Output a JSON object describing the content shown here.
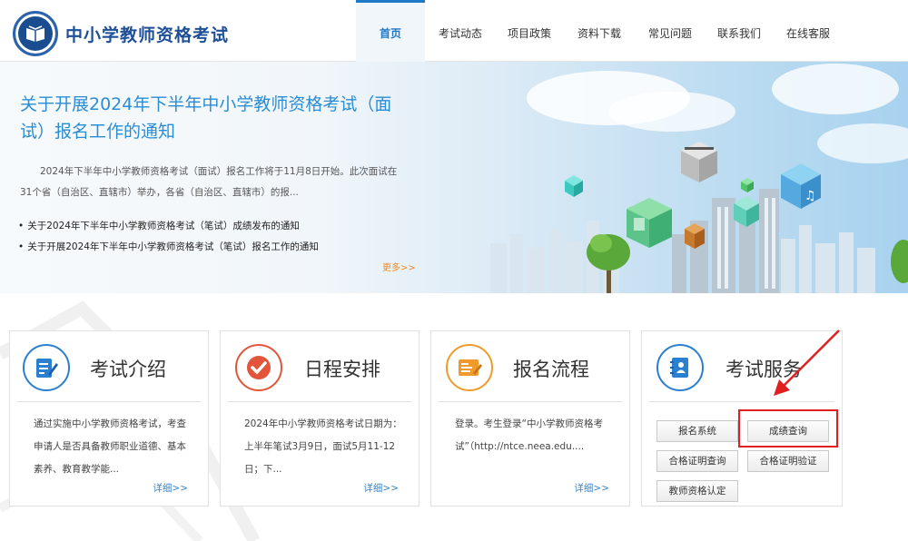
{
  "header": {
    "site_title": "中小学教师资格考试",
    "nav": [
      {
        "label": "首页",
        "active": true
      },
      {
        "label": "考试动态",
        "active": false
      },
      {
        "label": "项目政策",
        "active": false
      },
      {
        "label": "资料下载",
        "active": false
      },
      {
        "label": "常见问题",
        "active": false
      },
      {
        "label": "联系我们",
        "active": false
      },
      {
        "label": "在线客服",
        "active": false
      }
    ]
  },
  "banner": {
    "headline": "关于开展2024年下半年中小学教师资格考试（面试）报名工作的通知",
    "summary": "2024年下半年中小学教师资格考试（面试）报名工作将于11月8日开始。此次面试在31个省（自治区、直辖市）举办，各省（自治区、直辖市）的报...",
    "links": [
      "关于2024年下半年中小学教师资格考试（笔试）成绩发布的通知",
      "关于开展2024年下半年中小学教师资格考试（笔试）报名工作的通知"
    ],
    "more": "更多>>"
  },
  "cards": [
    {
      "title": "考试介绍",
      "icon": "document-edit-icon",
      "body": "通过实施中小学教师资格考试，考查申请人是否具备教师职业道德、基本素养、教育教学能...",
      "more": "详细>>"
    },
    {
      "title": "日程安排",
      "icon": "checkmark-icon",
      "body": "2024年中小学教师资格考试日期为：上半年笔试3月9日，面试5月11-12日；下...",
      "more": "详细>>"
    },
    {
      "title": "报名流程",
      "icon": "edit-form-icon",
      "body": "登录。考生登录“中小学教师资格考试”（http://ntce.neea.edu....",
      "more": "详细>>"
    },
    {
      "title": "考试服务",
      "icon": "contacts-book-icon",
      "services": [
        "报名系统",
        "成绩查询",
        "合格证明查询",
        "合格证明验证",
        "教师资格认定"
      ]
    }
  ],
  "colors": {
    "brand_blue": "#1e4f97",
    "link_blue": "#2a8dd4",
    "accent_orange": "#f08a24",
    "card1_icon": "#2a7fd0",
    "card2_icon": "#e2553a",
    "card3_icon": "#ef9a2a",
    "card4_icon": "#2a7fd0",
    "annotation_red": "#e02020"
  }
}
